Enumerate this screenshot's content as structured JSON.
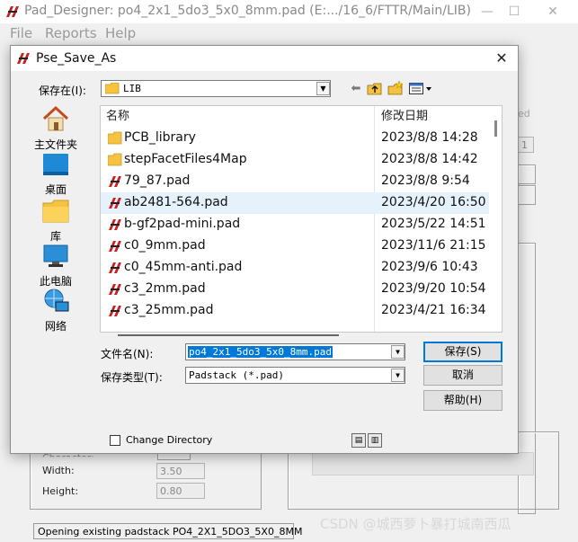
{
  "main_window": {
    "title": "Pad_Designer: po4_2x1_5do3_5x0_8mm.pad (E:.../16_6/FTTR/Main/LIB)",
    "minimize": "—",
    "maximize": "☐",
    "close": "✕",
    "menu": [
      "File",
      "Reports",
      "Help"
    ],
    "labels": {
      "width": "Width:",
      "height": "Height:",
      "partial": "Character:",
      "right_partial": "ed"
    },
    "fields": {
      "width": "3.50",
      "height": "0.80",
      "right_value": "1"
    },
    "status": "Opening existing padstack PO4_2X1_5DO3_5X0_8MM"
  },
  "dialog": {
    "title": "Pse_Save_As",
    "close": "✕",
    "save_in_label": "保存在(I):",
    "save_in_value": "LIB",
    "places": [
      {
        "label": "主文件夹",
        "icon": "home-icon"
      },
      {
        "label": "桌面",
        "icon": "desktop-icon"
      },
      {
        "label": "库",
        "icon": "library-icon"
      },
      {
        "label": "此电脑",
        "icon": "computer-icon"
      },
      {
        "label": "网络",
        "icon": "network-icon"
      }
    ],
    "columns": {
      "name": "名称",
      "date": "修改日期"
    },
    "files": [
      {
        "name": "PCB_library",
        "date": "2023/8/8 14:28",
        "type": "folder",
        "selected": false
      },
      {
        "name": "stepFacetFiles4Map",
        "date": "2023/8/8 14:42",
        "type": "folder",
        "selected": false
      },
      {
        "name": "79_87.pad",
        "date": "2023/8/8 9:54",
        "type": "pad",
        "selected": false
      },
      {
        "name": "ab2481-564.pad",
        "date": "2023/4/20 16:50",
        "type": "pad",
        "selected": true
      },
      {
        "name": "b-gf2pad-mini.pad",
        "date": "2023/5/22 14:51",
        "type": "pad",
        "selected": false
      },
      {
        "name": "c0_9mm.pad",
        "date": "2023/11/6 21:15",
        "type": "pad",
        "selected": false
      },
      {
        "name": "c0_45mm-anti.pad",
        "date": "2023/9/6 10:43",
        "type": "pad",
        "selected": false
      },
      {
        "name": "c3_2mm.pad",
        "date": "2023/9/20 10:54",
        "type": "pad",
        "selected": false
      },
      {
        "name": "c3_25mm.pad",
        "date": "2023/4/21 16:34",
        "type": "pad",
        "selected": false
      }
    ],
    "filename_label": "文件名(N):",
    "filename_value": "po4_2x1_5do3_5x0_8mm.pad",
    "filetype_label": "保存类型(T):",
    "filetype_value": "Padstack (*.pad)",
    "buttons": {
      "save": "保存(S)",
      "cancel": "取消",
      "help": "帮助(H)"
    },
    "change_directory": "Change Directory"
  },
  "watermark": "CSDN @城西萝卜暴打城南西瓜",
  "colors": {
    "selection": "#e5f1fb",
    "text_highlight": "#0078d7",
    "folder": "#f5c242",
    "pad_icon": "#cc1f1f"
  }
}
